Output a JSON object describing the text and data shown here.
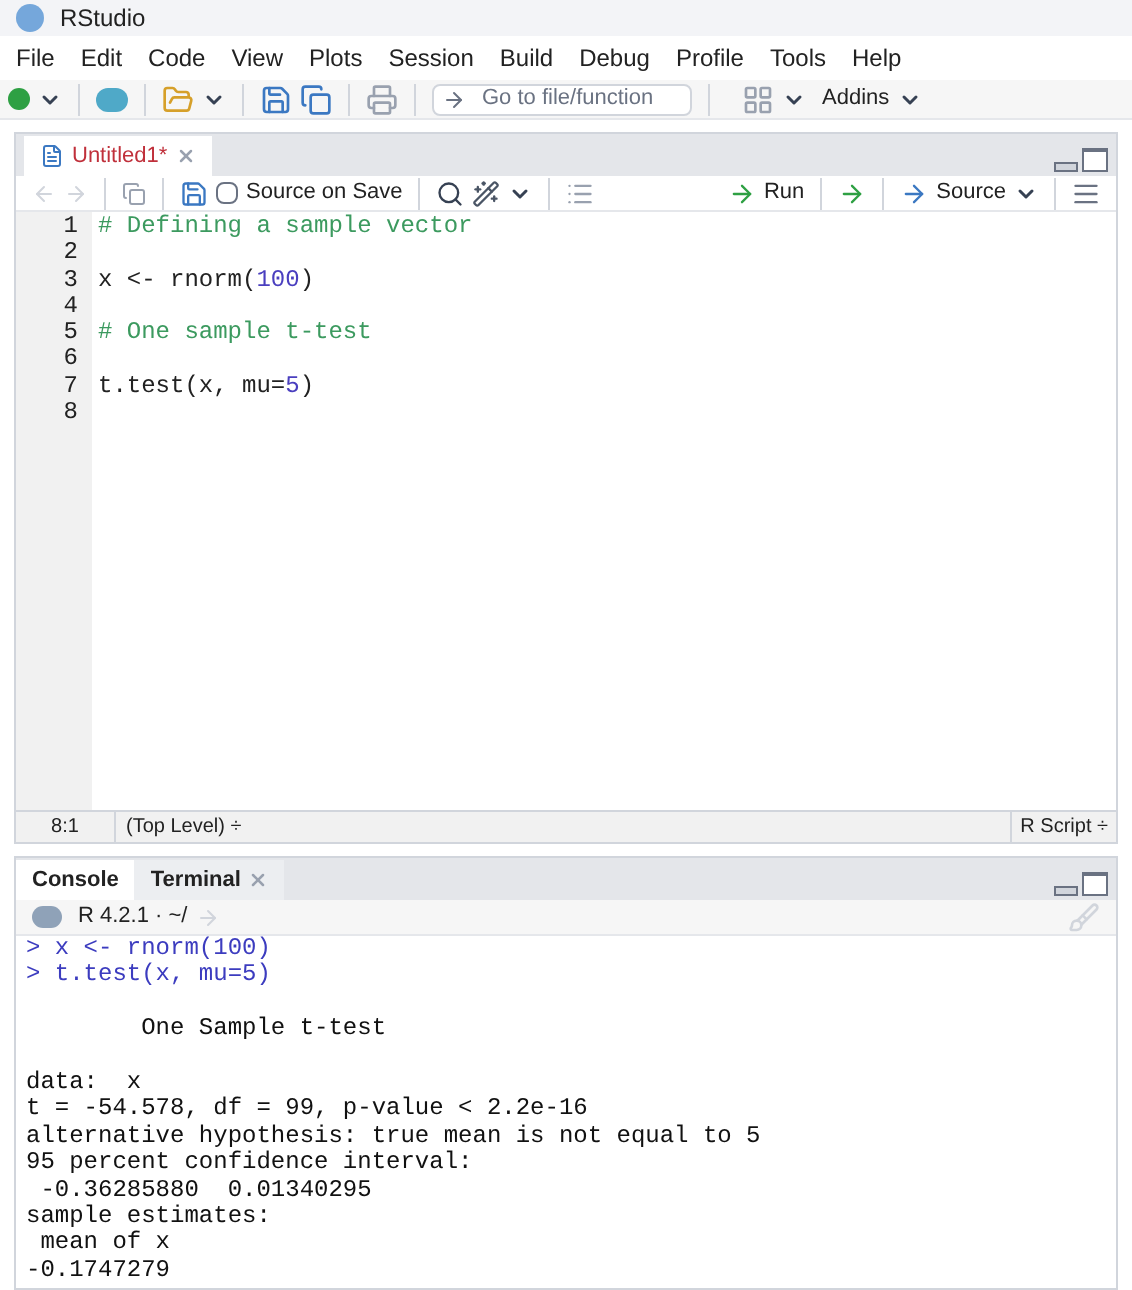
{
  "window": {
    "title": "RStudio"
  },
  "menu": [
    "File",
    "Edit",
    "Code",
    "View",
    "Plots",
    "Session",
    "Build",
    "Debug",
    "Profile",
    "Tools",
    "Help"
  ],
  "toolbar": {
    "goto_placeholder": "Go to file/function",
    "addins": "Addins"
  },
  "editor": {
    "tabs": [
      {
        "label": "Untitled1*",
        "selected": true,
        "modified": true
      }
    ],
    "source_on_save": {
      "label": "Source on Save",
      "checked": false
    },
    "run": "Run",
    "source": "Source",
    "lines": [
      {
        "number": "1",
        "tokens": [
          {
            "text": "# Defining a sample vector",
            "kind": "comment"
          }
        ]
      },
      {
        "number": "2"
      },
      {
        "number": "3",
        "tokens": [
          {
            "text": "x <- rnorm(",
            "kind": "plain"
          },
          {
            "text": "100",
            "kind": "number"
          },
          {
            "text": ")",
            "kind": "plain"
          }
        ]
      },
      {
        "number": "4"
      },
      {
        "number": "5",
        "tokens": [
          {
            "text": "# One sample t-test",
            "kind": "comment"
          }
        ]
      },
      {
        "number": "6"
      },
      {
        "number": "7",
        "tokens": [
          {
            "text": "t.test(x, mu=",
            "kind": "plain"
          },
          {
            "text": "5",
            "kind": "number"
          },
          {
            "text": ")",
            "kind": "plain"
          }
        ]
      },
      {
        "number": "8"
      }
    ],
    "status": {
      "position": "8:1",
      "scope": "(Top Level) ÷",
      "filetype": "R Script ÷"
    }
  },
  "console": {
    "tabs": [
      {
        "label": "Console",
        "selected": true
      },
      {
        "label": "Terminal",
        "selected": false
      }
    ],
    "version": "R 4.2.1 · ~/",
    "lines": [
      {
        "text": "> x <- rnorm(100)",
        "kind": "input"
      },
      {
        "text": "> t.test(x, mu=5)",
        "kind": "input"
      },
      {
        "kind": "blank"
      },
      {
        "text": "        One Sample t-test",
        "kind": "output"
      },
      {
        "kind": "blank"
      },
      {
        "text": "data:  x",
        "kind": "output"
      },
      {
        "text": "t = -54.578, df = 99, p-value < 2.2e-16",
        "kind": "output"
      },
      {
        "text": "alternative hypothesis: true mean is not equal to 5",
        "kind": "output"
      },
      {
        "text": "95 percent confidence interval:",
        "kind": "output"
      },
      {
        "text": " -0.36285880  0.01340295",
        "kind": "output"
      },
      {
        "text": "sample estimates:",
        "kind": "output"
      },
      {
        "text": " mean of x",
        "kind": "output"
      },
      {
        "text": "-0.1747279",
        "kind": "output"
      }
    ]
  }
}
